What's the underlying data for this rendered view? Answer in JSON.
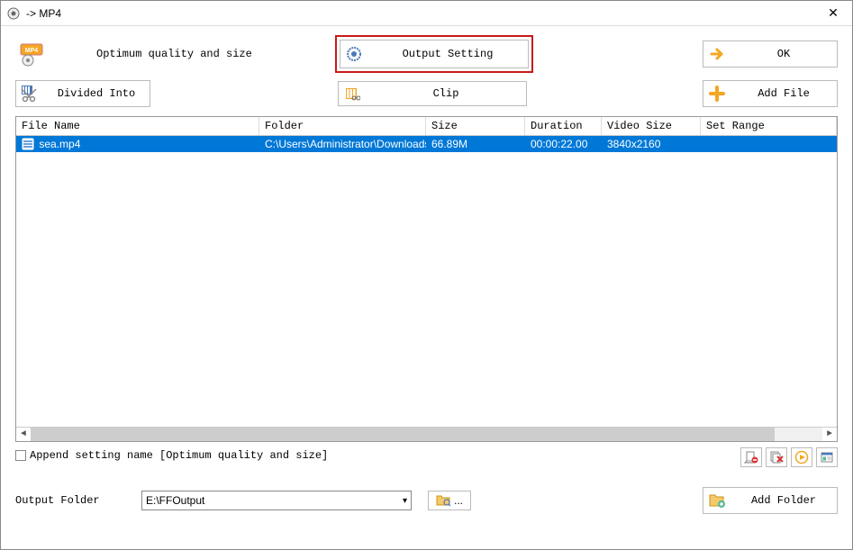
{
  "window": {
    "title": " -> MP4"
  },
  "row1": {
    "quality_label": "Optimum quality and size",
    "output_setting": "Output Setting",
    "ok": "OK"
  },
  "row2": {
    "divided_into": "Divided Into",
    "clip": "Clip",
    "add_file": "Add File"
  },
  "columns": {
    "filename": "File Name",
    "folder": "Folder",
    "size": "Size",
    "duration": "Duration",
    "videosize": "Video Size",
    "setrange": "Set Range"
  },
  "rows": [
    {
      "filename": "sea.mp4",
      "folder": "C:\\Users\\Administrator\\Downloads",
      "size": "66.89M",
      "duration": "00:00:22.00",
      "videosize": "3840x2160",
      "setrange": ""
    }
  ],
  "append_checkbox_label": "Append setting name [Optimum quality and size]",
  "output": {
    "label": "Output Folder",
    "value": "E:\\FFOutput",
    "browse_dots": "..."
  },
  "add_folder": "Add Folder"
}
